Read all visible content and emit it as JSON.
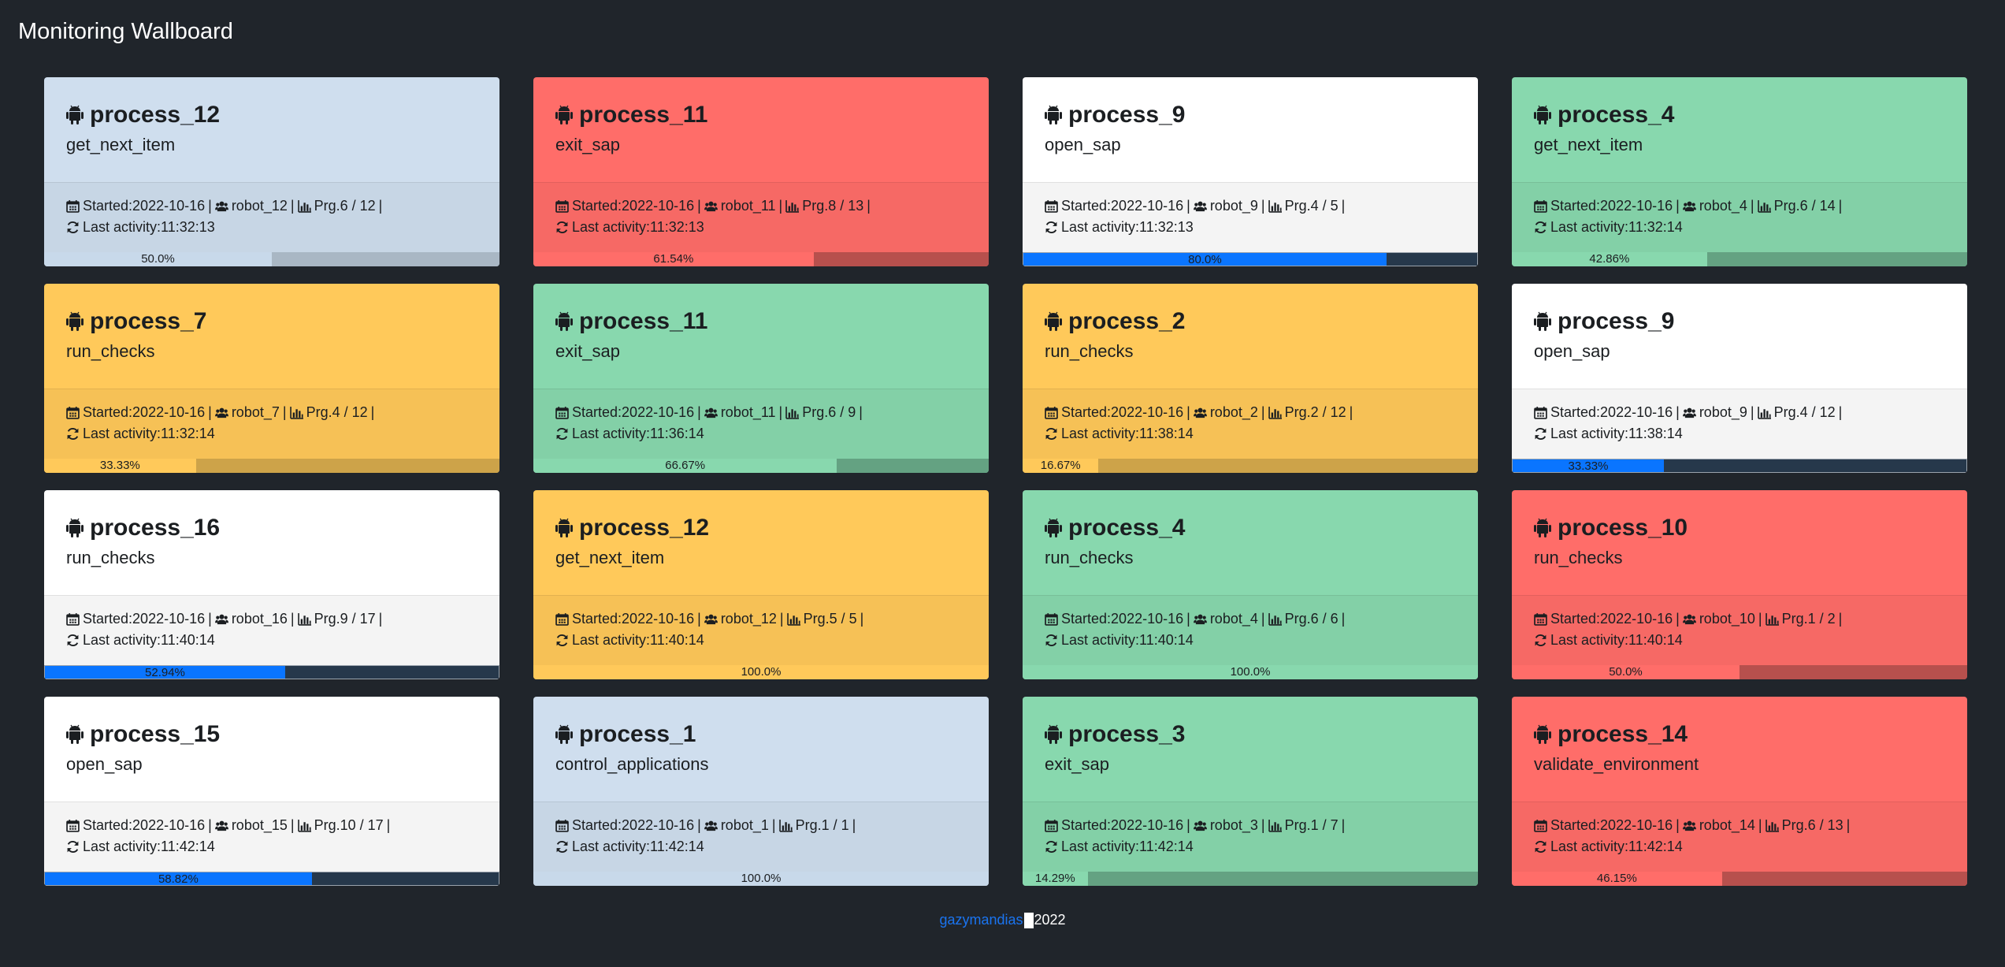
{
  "page": {
    "title": "Monitoring Wallboard"
  },
  "labels": {
    "started_prefix": "Started: ",
    "progress_prefix": "Prg. ",
    "last_activity_prefix": "Last activity: "
  },
  "icons": {
    "process": "android-icon",
    "calendar": "calendar-icon",
    "users": "users-icon",
    "chart": "bar-chart-icon",
    "refresh": "refresh-icon"
  },
  "colors": {
    "background": "#20252b",
    "blue": "#cfdeee",
    "red": "#ff6d69",
    "white": "#ffffff",
    "green": "#88d8ae",
    "yellow": "#ffc95a",
    "progress_blue": "#0a75ff"
  },
  "cards": [
    {
      "theme": "blue",
      "name": "process_12",
      "task": "get_next_item",
      "started": "2022-10-16",
      "robot": "robot_12",
      "progress": "6 / 12",
      "last_activity": "11:32:13",
      "percent": "50.0%",
      "fraction": 0.5
    },
    {
      "theme": "red",
      "name": "process_11",
      "task": "exit_sap",
      "started": "2022-10-16",
      "robot": "robot_11",
      "progress": "8 / 13",
      "last_activity": "11:32:13",
      "percent": "61.54%",
      "fraction": 0.6154
    },
    {
      "theme": "white",
      "name": "process_9",
      "task": "open_sap",
      "started": "2022-10-16",
      "robot": "robot_9",
      "progress": "4 / 5",
      "last_activity": "11:32:13",
      "percent": "80.0%",
      "fraction": 0.8
    },
    {
      "theme": "green",
      "name": "process_4",
      "task": "get_next_item",
      "started": "2022-10-16",
      "robot": "robot_4",
      "progress": "6 / 14",
      "last_activity": "11:32:14",
      "percent": "42.86%",
      "fraction": 0.4286
    },
    {
      "theme": "yellow",
      "name": "process_7",
      "task": "run_checks",
      "started": "2022-10-16",
      "robot": "robot_7",
      "progress": "4 / 12",
      "last_activity": "11:32:14",
      "percent": "33.33%",
      "fraction": 0.3333
    },
    {
      "theme": "green",
      "name": "process_11",
      "task": "exit_sap",
      "started": "2022-10-16",
      "robot": "robot_11",
      "progress": "6 / 9",
      "last_activity": "11:36:14",
      "percent": "66.67%",
      "fraction": 0.6667
    },
    {
      "theme": "yellow",
      "name": "process_2",
      "task": "run_checks",
      "started": "2022-10-16",
      "robot": "robot_2",
      "progress": "2 / 12",
      "last_activity": "11:38:14",
      "percent": "16.67%",
      "fraction": 0.1667
    },
    {
      "theme": "white",
      "name": "process_9",
      "task": "open_sap",
      "started": "2022-10-16",
      "robot": "robot_9",
      "progress": "4 / 12",
      "last_activity": "11:38:14",
      "percent": "33.33%",
      "fraction": 0.3333
    },
    {
      "theme": "white",
      "name": "process_16",
      "task": "run_checks",
      "started": "2022-10-16",
      "robot": "robot_16",
      "progress": "9 / 17",
      "last_activity": "11:40:14",
      "percent": "52.94%",
      "fraction": 0.5294
    },
    {
      "theme": "yellow",
      "name": "process_12",
      "task": "get_next_item",
      "started": "2022-10-16",
      "robot": "robot_12",
      "progress": "5 / 5",
      "last_activity": "11:40:14",
      "percent": "100.0%",
      "fraction": 1.0
    },
    {
      "theme": "green",
      "name": "process_4",
      "task": "run_checks",
      "started": "2022-10-16",
      "robot": "robot_4",
      "progress": "6 / 6",
      "last_activity": "11:40:14",
      "percent": "100.0%",
      "fraction": 1.0
    },
    {
      "theme": "red",
      "name": "process_10",
      "task": "run_checks",
      "started": "2022-10-16",
      "robot": "robot_10",
      "progress": "1 / 2",
      "last_activity": "11:40:14",
      "percent": "50.0%",
      "fraction": 0.5
    },
    {
      "theme": "white",
      "name": "process_15",
      "task": "open_sap",
      "started": "2022-10-16",
      "robot": "robot_15",
      "progress": "10 / 17",
      "last_activity": "11:42:14",
      "percent": "58.82%",
      "fraction": 0.5882
    },
    {
      "theme": "blue",
      "name": "process_1",
      "task": "control_applications",
      "started": "2022-10-16",
      "robot": "robot_1",
      "progress": "1 / 1",
      "last_activity": "11:42:14",
      "percent": "100.0%",
      "fraction": 1.0
    },
    {
      "theme": "green",
      "name": "process_3",
      "task": "exit_sap",
      "started": "2022-10-16",
      "robot": "robot_3",
      "progress": "1 / 7",
      "last_activity": "11:42:14",
      "percent": "14.29%",
      "fraction": 0.1429
    },
    {
      "theme": "red",
      "name": "process_14",
      "task": "validate_environment",
      "started": "2022-10-16",
      "robot": "robot_14",
      "progress": "6 / 13",
      "last_activity": "11:42:14",
      "percent": "46.15%",
      "fraction": 0.4615
    }
  ],
  "footer": {
    "link_text": "gazymandias",
    "year": "2022"
  }
}
